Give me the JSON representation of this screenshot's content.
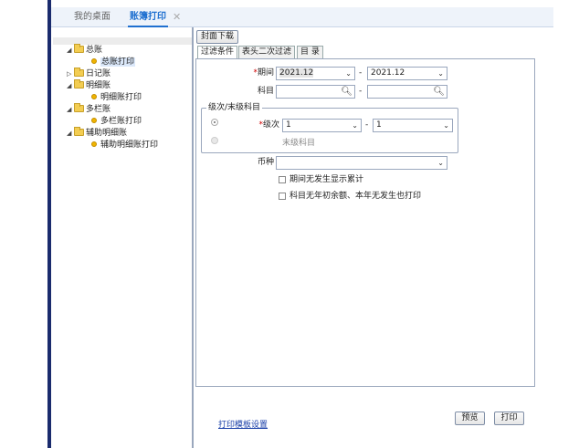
{
  "tabs": [
    {
      "label": "我的桌面",
      "active": false
    },
    {
      "label": "账簿打印",
      "active": true
    }
  ],
  "tree": [
    {
      "label": "总账",
      "level": 0,
      "expanded": true
    },
    {
      "label": "总账打印",
      "level": 1,
      "highlighted": true
    },
    {
      "label": "日记账",
      "level": 0,
      "expanded": false
    },
    {
      "label": "明细账",
      "level": 0,
      "expanded": true
    },
    {
      "label": "明细账打印",
      "level": 1
    },
    {
      "label": "多栏账",
      "level": 0,
      "expanded": true
    },
    {
      "label": "多栏账打印",
      "level": 1
    },
    {
      "label": "辅助明细账",
      "level": 0,
      "expanded": true
    },
    {
      "label": "辅助明细账打印",
      "level": 1
    }
  ],
  "cover_button": "封面下载",
  "filter_tabs": [
    "过滤条件",
    "表头二次过滤",
    "目 录"
  ],
  "filter": {
    "period_label": "期间",
    "period_from": "2021.12",
    "period_to": "2021.12",
    "subject_label": "科目",
    "subject_from": "",
    "subject_to": "",
    "group_title": "级次/末级科目",
    "level_label": "级次",
    "level_from": "1",
    "level_to": "1",
    "leaf_subject_label": "末级科目",
    "currency_label": "币种",
    "currency_value": "",
    "options": [
      {
        "label": "期间无发生显示累计",
        "checked": false
      },
      {
        "label": "科目无年初余额、本年无发生也打印",
        "checked": false
      }
    ],
    "dash": "-",
    "required_mark": "*"
  },
  "footer": {
    "template_link": "打印模板设置",
    "preview_button": "预览",
    "print_button": "打印"
  },
  "colors": {
    "accent": "#1f70d0",
    "left_bar": "#1a2b6d",
    "required": "#d00000"
  }
}
